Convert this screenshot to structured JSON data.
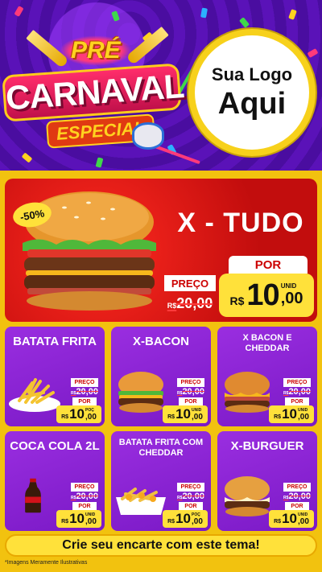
{
  "header": {
    "carnaval_logo": {
      "line1": "PRÉ",
      "line2": "CARNAVAL",
      "line3": "ESPECIAL"
    },
    "store_logo": {
      "line1": "Sua Logo",
      "line2": "Aqui"
    }
  },
  "featured": {
    "title": "X - TUDO",
    "discount": "-50%",
    "preco_label": "PREÇO",
    "old_price": {
      "currency": "R$",
      "value": "20,00"
    },
    "por_label": "POR",
    "new_price": {
      "currency": "R$",
      "integer": "10",
      "decimals": ",00",
      "unit": "UNID"
    }
  },
  "products": [
    {
      "name": "BATATA FRITA",
      "size": "lg",
      "preco_label": "PREÇO",
      "old_currency": "R$",
      "old_value": "20,00",
      "por_label": "POR",
      "currency": "R$",
      "integer": "10",
      "decimals": ",00",
      "unit": "POÇ"
    },
    {
      "name": "X-BACON",
      "size": "lg",
      "preco_label": "PREÇO",
      "old_currency": "R$",
      "old_value": "20,00",
      "por_label": "POR",
      "currency": "R$",
      "integer": "10",
      "decimals": ",00",
      "unit": "UNID"
    },
    {
      "name": "X BACON E CHEDDAR",
      "size": "sm",
      "preco_label": "PREÇO",
      "old_currency": "R$",
      "old_value": "20,00",
      "por_label": "POR",
      "currency": "R$",
      "integer": "10",
      "decimals": ",00",
      "unit": "UNID"
    },
    {
      "name": "COCA COLA 2L",
      "size": "lg",
      "preco_label": "PREÇO",
      "old_currency": "R$",
      "old_value": "20,00",
      "por_label": "POR",
      "currency": "R$",
      "integer": "10",
      "decimals": ",00",
      "unit": "UNID"
    },
    {
      "name": "BATATA FRITA COM CHEDDAR",
      "size": "sm",
      "preco_label": "PREÇO",
      "old_currency": "R$",
      "old_value": "20,00",
      "por_label": "POR",
      "currency": "R$",
      "integer": "10",
      "decimals": ",00",
      "unit": "POÇ"
    },
    {
      "name": "X-BURGUER",
      "size": "lg",
      "preco_label": "PREÇO",
      "old_currency": "R$",
      "old_value": "20,00",
      "por_label": "POR",
      "currency": "R$",
      "integer": "10",
      "decimals": ",00",
      "unit": "UNID"
    }
  ],
  "cta": {
    "label": "Crie seu encarte com este tema!"
  },
  "footnote": "*Imagens Meramente Ilustrativas",
  "colors": {
    "purple": "#7a19c6",
    "yellow": "#ffe13a",
    "red": "#c20d0d",
    "background": "#f2c20f"
  },
  "icons": {
    "featured": "burger-icon",
    "products": [
      "fries-icon",
      "burger-icon",
      "burger-icon",
      "soda-bottle-icon",
      "fries-tray-icon",
      "burger-icon"
    ]
  }
}
